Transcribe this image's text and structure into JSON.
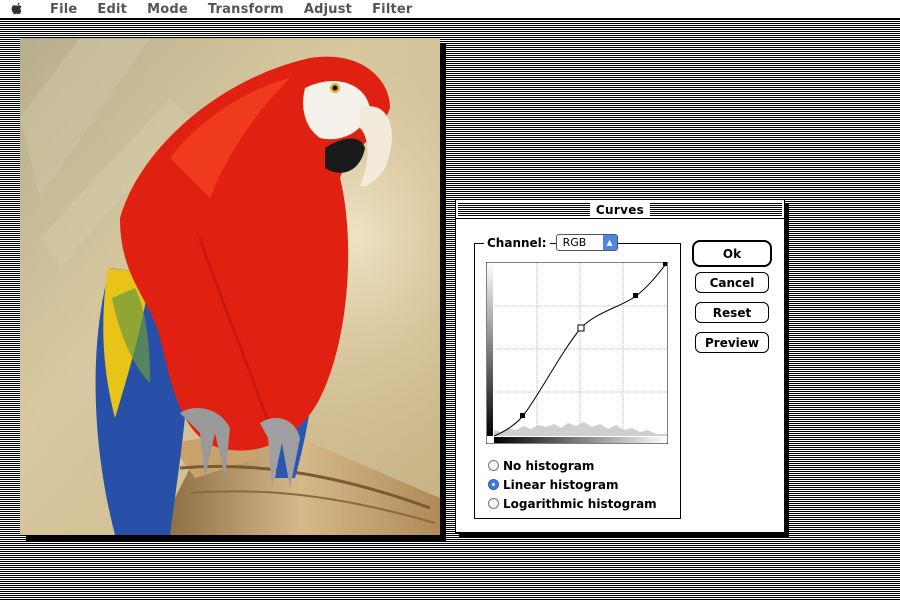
{
  "menubar": {
    "items": [
      "File",
      "Edit",
      "Mode",
      "Transform",
      "Adjust",
      "Filter"
    ]
  },
  "dialog": {
    "title": "Curves",
    "channel_label": "Channel:",
    "channel_value": "RGB",
    "buttons": {
      "ok": "Ok",
      "cancel": "Cancel",
      "reset": "Reset",
      "preview": "Preview"
    },
    "histogram_options": [
      {
        "label": "No histogram",
        "selected": false
      },
      {
        "label": "Linear histogram",
        "selected": true
      },
      {
        "label": "Logarithmic histogram",
        "selected": false
      }
    ]
  },
  "colors": {
    "accent": "#3d7de0",
    "parrot_red": "#e02010"
  },
  "icons": {
    "apple": "apple-logo-icon",
    "popup": "popup-arrows-icon"
  }
}
